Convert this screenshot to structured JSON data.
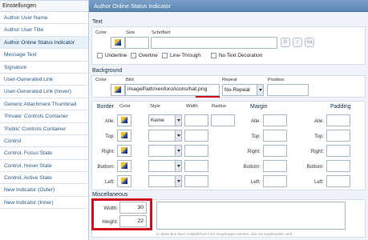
{
  "sidebar": {
    "header": "Einstellungen",
    "items": [
      {
        "label": "Author User Name"
      },
      {
        "label": "Author User Title"
      },
      {
        "label": "Author Online Status Indicator"
      },
      {
        "label": "Message Text"
      },
      {
        "label": "Signature"
      },
      {
        "label": "User-Generated Link"
      },
      {
        "label": "User-Generated Link (hover)"
      },
      {
        "label": "Generic Attachment Thumbnail"
      },
      {
        "label": "'Private' Controls Container"
      },
      {
        "label": "'Public' Controls Container"
      },
      {
        "label": "Control"
      },
      {
        "label": "Control, Focus State"
      },
      {
        "label": "Control, Hover State"
      },
      {
        "label": "Control, Active State"
      },
      {
        "label": "New Indicator (Outer)"
      },
      {
        "label": "New Indicator (Inner)"
      }
    ],
    "active_index": 2
  },
  "panel": {
    "title": "Author Online Status Indicator"
  },
  "text_section": {
    "heading": "Text",
    "color_label": "Color",
    "size_label": "Size",
    "font_label": "Schriftart",
    "bold_btn": "B",
    "italic_btn": "I",
    "size_btn": "Aa",
    "decorations": [
      "Underline",
      "Overline",
      "Line-Through",
      "No Text Decoration"
    ]
  },
  "background_section": {
    "heading": "Background",
    "color_label": "Color",
    "image_label": "Bild",
    "image_value": "imagePath/xenforo/icons/hat.png",
    "repeat_label": "Repeat",
    "repeat_value": "No-Repeat",
    "position_label": "Position"
  },
  "border_section": {
    "heading": "Border",
    "color_label": "Color",
    "style_label": "Style",
    "width_label": "Width",
    "radius_label": "Radius",
    "style_value": "Keine",
    "rows": [
      "Alle:",
      "Top:",
      "Right:",
      "Bottom:",
      "Left:"
    ]
  },
  "margin_section": {
    "heading": "Margin",
    "rows": [
      "Alle:",
      "Top:",
      "Right:",
      "Bottom:",
      "Left:"
    ]
  },
  "padding_section": {
    "heading": "Padding",
    "rows": [
      "Alle:",
      "Top:",
      "Right:",
      "Bottom:",
      "Left:"
    ]
  },
  "misc_section": {
    "heading": "Miscellaneous",
    "width_label": "Width:",
    "width_value": "30",
    "height_label": "Height:",
    "height_value": "22",
    "css_hint": "In diese Box kann zusätzliches CSS eingetragen werden, das mit angebunden wird."
  },
  "colors": {
    "highlight": "#d01020",
    "panel_title_bg": "#5b86b2",
    "link": "#2a5a8a"
  }
}
